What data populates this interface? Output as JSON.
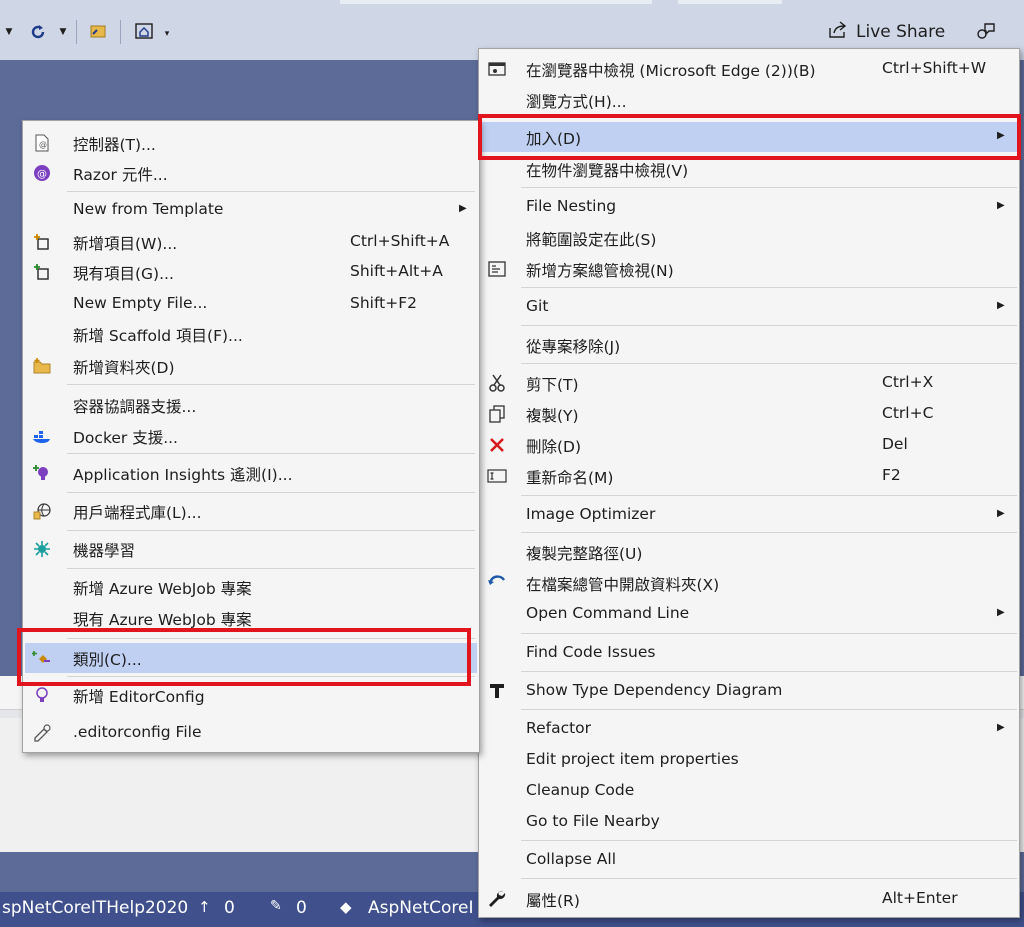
{
  "toolbar": {
    "refresh_icon": "refresh-icon",
    "live_share_label": "Live Share"
  },
  "status_bar": {
    "project": "spNetCoreITHelp2020",
    "up_count": "0",
    "edit_count": "0",
    "repo": "AspNetCoreI"
  },
  "left_menu": {
    "items": [
      {
        "label": "控制器(T)...",
        "icon": "controller-icon",
        "shortcut": "",
        "arrow": false
      },
      {
        "label": "Razor 元件...",
        "icon": "razor-icon",
        "shortcut": "",
        "arrow": false
      },
      {
        "label": "New from Template",
        "icon": "",
        "shortcut": "",
        "arrow": true
      },
      {
        "label": "新增項目(W)...",
        "icon": "new-item-icon",
        "shortcut": "Ctrl+Shift+A",
        "arrow": false
      },
      {
        "label": "現有項目(G)...",
        "icon": "existing-item-icon",
        "shortcut": "Shift+Alt+A",
        "arrow": false
      },
      {
        "label": "New Empty File...",
        "icon": "",
        "shortcut": "Shift+F2",
        "arrow": false
      },
      {
        "label": "新增 Scaffold 項目(F)...",
        "icon": "",
        "shortcut": "",
        "arrow": false
      },
      {
        "label": "新增資料夾(D)",
        "icon": "new-folder-icon",
        "shortcut": "",
        "arrow": false
      },
      {
        "label": "容器協調器支援...",
        "icon": "",
        "shortcut": "",
        "arrow": false
      },
      {
        "label": "Docker 支援...",
        "icon": "docker-icon",
        "shortcut": "",
        "arrow": false
      },
      {
        "label": "Application Insights 遙測(I)...",
        "icon": "app-insights-icon",
        "shortcut": "",
        "arrow": false
      },
      {
        "label": "用戶端程式庫(L)...",
        "icon": "client-library-icon",
        "shortcut": "",
        "arrow": false
      },
      {
        "label": "機器學習",
        "icon": "machine-learning-icon",
        "shortcut": "",
        "arrow": false
      },
      {
        "label": "新增 Azure WebJob 專案",
        "icon": "",
        "shortcut": "",
        "arrow": false
      },
      {
        "label": "現有 Azure WebJob 專案",
        "icon": "",
        "shortcut": "",
        "arrow": false
      },
      {
        "label": "類別(C)...",
        "icon": "class-icon",
        "shortcut": "",
        "arrow": false
      },
      {
        "label": "新增 EditorConfig",
        "icon": "editorconfig-icon",
        "shortcut": "",
        "arrow": false
      },
      {
        "label": ".editorconfig File",
        "icon": "editorconfig-file-icon",
        "shortcut": "",
        "arrow": false
      }
    ]
  },
  "right_menu": {
    "items": [
      {
        "label": "在瀏覽器中檢視 (Microsoft Edge (2))(B)",
        "icon": "browser-view-icon",
        "shortcut": "Ctrl+Shift+W",
        "arrow": false
      },
      {
        "label": "瀏覽方式(H)...",
        "icon": "",
        "shortcut": "",
        "arrow": false
      },
      {
        "label": "加入(D)",
        "icon": "",
        "shortcut": "",
        "arrow": true
      },
      {
        "label": "在物件瀏覽器中檢視(V)",
        "icon": "",
        "shortcut": "",
        "arrow": false
      },
      {
        "label": "File Nesting",
        "icon": "",
        "shortcut": "",
        "arrow": true
      },
      {
        "label": "將範圍設定在此(S)",
        "icon": "",
        "shortcut": "",
        "arrow": false
      },
      {
        "label": "新增方案總管檢視(N)",
        "icon": "solution-explorer-view-icon",
        "shortcut": "",
        "arrow": false
      },
      {
        "label": "Git",
        "icon": "",
        "shortcut": "",
        "arrow": true
      },
      {
        "label": "從專案移除(J)",
        "icon": "",
        "shortcut": "",
        "arrow": false
      },
      {
        "label": "剪下(T)",
        "icon": "cut-icon",
        "shortcut": "Ctrl+X",
        "arrow": false
      },
      {
        "label": "複製(Y)",
        "icon": "copy-icon",
        "shortcut": "Ctrl+C",
        "arrow": false
      },
      {
        "label": "刪除(D)",
        "icon": "delete-icon",
        "shortcut": "Del",
        "arrow": false
      },
      {
        "label": "重新命名(M)",
        "icon": "rename-icon",
        "shortcut": "F2",
        "arrow": false
      },
      {
        "label": "Image Optimizer",
        "icon": "",
        "shortcut": "",
        "arrow": true
      },
      {
        "label": "複製完整路徑(U)",
        "icon": "",
        "shortcut": "",
        "arrow": false
      },
      {
        "label": "在檔案總管中開啟資料夾(X)",
        "icon": "open-folder-icon",
        "shortcut": "",
        "arrow": false
      },
      {
        "label": "Open Command Line",
        "icon": "",
        "shortcut": "",
        "arrow": true
      },
      {
        "label": "Find Code Issues",
        "icon": "",
        "shortcut": "",
        "arrow": false
      },
      {
        "label": "Show Type Dependency Diagram",
        "icon": "type-dependency-icon",
        "shortcut": "",
        "arrow": false
      },
      {
        "label": "Refactor",
        "icon": "",
        "shortcut": "",
        "arrow": true
      },
      {
        "label": "Edit project item properties",
        "icon": "",
        "shortcut": "",
        "arrow": false
      },
      {
        "label": "Cleanup Code",
        "icon": "",
        "shortcut": "",
        "arrow": false
      },
      {
        "label": "Go to File Nearby",
        "icon": "",
        "shortcut": "",
        "arrow": false
      },
      {
        "label": "Collapse All",
        "icon": "",
        "shortcut": "",
        "arrow": false
      },
      {
        "label": "屬性(R)",
        "icon": "properties-wrench-icon",
        "shortcut": "Alt+Enter",
        "arrow": false
      }
    ]
  },
  "colors": {
    "highlight": "#bfd0f2",
    "annotation_red": "#e2141e",
    "status_bar": "#40508d",
    "editor_background": "#5d6b99"
  }
}
